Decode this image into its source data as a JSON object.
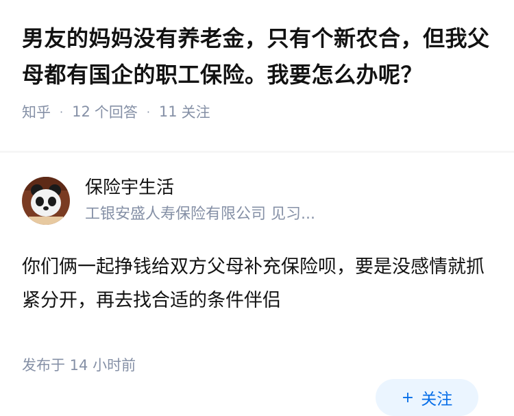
{
  "question": {
    "title": "男友的妈妈没有养老金，只有个新农合，但我父母都有国企的职工保险。我要怎么办呢？",
    "source": "知乎",
    "dot": "·",
    "answers_count": "12",
    "answers_label": "个回答",
    "follow_count": "11",
    "follow_label": "关注"
  },
  "answer": {
    "author_name": "保险宇生活",
    "author_desc": "工银安盛人寿保险有限公司 见习...",
    "follow_plus": "+",
    "follow_label": "关注",
    "content": "你们俩一起挣钱给双方父母补充保险呗，要是没感情就抓紧分开，再去找合适的条件伴侣",
    "published": "发布于  14 小时前"
  },
  "colors": {
    "title": "#121212",
    "meta": "#8590a6",
    "accent": "#056de8",
    "button_bg": "#ebf5ff"
  }
}
